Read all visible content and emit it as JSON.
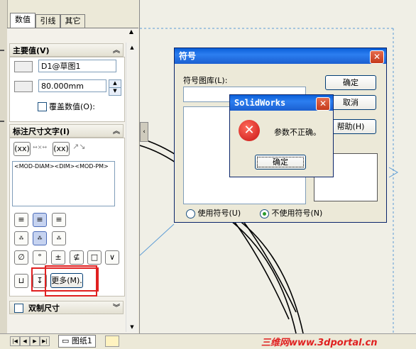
{
  "tabs": [
    "数值",
    "引线",
    "其它"
  ],
  "primary_value": {
    "header": "主要值(V)",
    "name_value": "D1@草图1",
    "dimension_value": "80.000mm",
    "override_label": "覆盖数值(O):"
  },
  "dim_text": {
    "header": "标注尺寸文字(I)",
    "text_value": "<MOD-DIAM><DIM><MOD-PM>",
    "bracket_label": "(xx)",
    "more_button": "更多(M).",
    "symbol_buttons": [
      "∅",
      "°",
      "±",
      "⊈",
      "□",
      "∨"
    ]
  },
  "dual_dimension": {
    "header": "双制尺寸"
  },
  "symbol_dialog": {
    "title": "符号",
    "library_label": "符号图库(L):",
    "ok_button": "确定",
    "cancel_button": "取消",
    "help_button": "帮助(H)",
    "radio_use": "使用符号(U)",
    "radio_no_use": "不使用符号(N)",
    "selected_radio": "radio_no_use"
  },
  "error_dialog": {
    "title": "SolidWorks",
    "message": "参数不正确。",
    "ok_button": "确定"
  },
  "bottom_bar": {
    "sheet_tab": "图纸1"
  },
  "watermark": "三维网www.3dportal.cn",
  "colors": {
    "title_blue": "#1b5fd0",
    "highlight_red": "#e02020",
    "error_red": "#d42020"
  }
}
